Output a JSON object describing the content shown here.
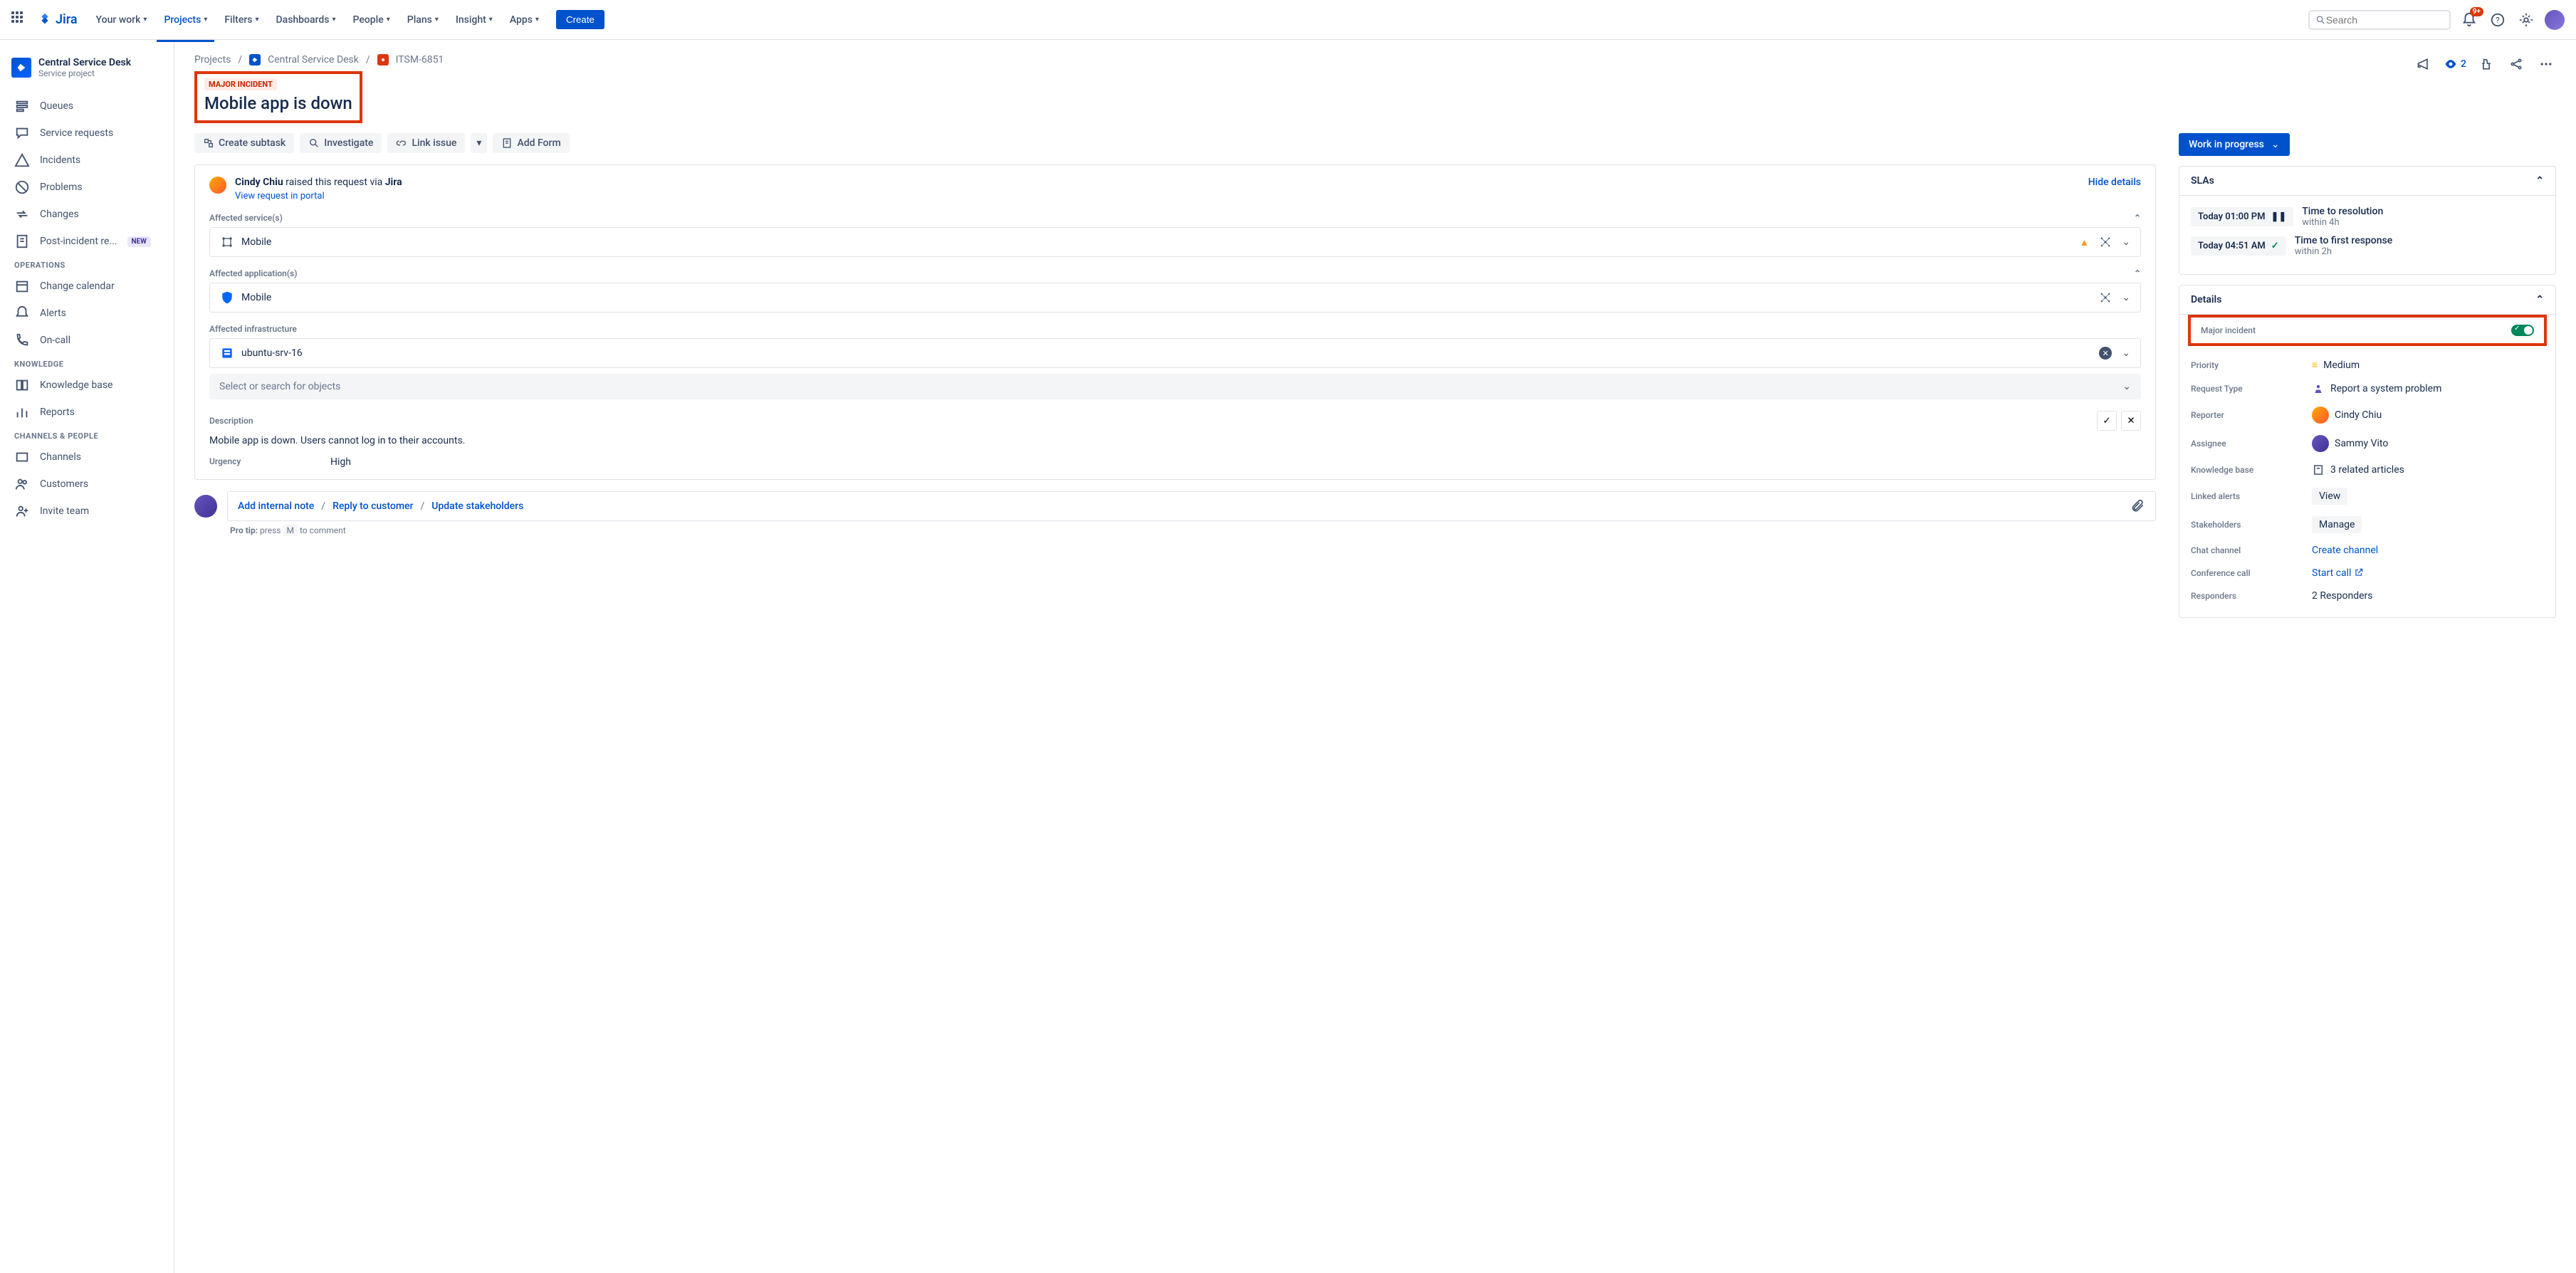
{
  "brand": "Jira",
  "nav": {
    "items": [
      "Your work",
      "Projects",
      "Filters",
      "Dashboards",
      "People",
      "Plans",
      "Insight",
      "Apps"
    ],
    "active_index": 1,
    "create": "Create",
    "search_placeholder": "Search",
    "notif_badge": "9+"
  },
  "project": {
    "name": "Central Service Desk",
    "type": "Service project"
  },
  "sidebar": {
    "main": [
      {
        "icon": "queues",
        "label": "Queues"
      },
      {
        "icon": "service",
        "label": "Service requests"
      },
      {
        "icon": "incidents",
        "label": "Incidents"
      },
      {
        "icon": "problems",
        "label": "Problems"
      },
      {
        "icon": "changes",
        "label": "Changes"
      },
      {
        "icon": "postinc",
        "label": "Post-incident re...",
        "badge": "NEW"
      }
    ],
    "operations_label": "OPERATIONS",
    "operations": [
      {
        "icon": "calendar",
        "label": "Change calendar"
      },
      {
        "icon": "alerts",
        "label": "Alerts"
      },
      {
        "icon": "oncall",
        "label": "On-call"
      }
    ],
    "knowledge_label": "KNOWLEDGE",
    "knowledge": [
      {
        "icon": "kb",
        "label": "Knowledge base"
      },
      {
        "icon": "reports",
        "label": "Reports"
      }
    ],
    "channels_label": "CHANNELS & PEOPLE",
    "channels": [
      {
        "icon": "channels",
        "label": "Channels"
      },
      {
        "icon": "customers",
        "label": "Customers"
      },
      {
        "icon": "invite",
        "label": "Invite team"
      }
    ]
  },
  "breadcrumb": {
    "root": "Projects",
    "project": "Central Service Desk",
    "key": "ITSM-6851"
  },
  "issue": {
    "badge": "MAJOR INCIDENT",
    "title": "Mobile app is down",
    "toolbar": {
      "subtask": "Create subtask",
      "investigate": "Investigate",
      "link": "Link issue",
      "form": "Add Form"
    },
    "requester": {
      "name": "Cindy Chiu",
      "text": " raised this request via ",
      "app": "Jira",
      "portal": "View request in portal",
      "hide": "Hide details"
    },
    "sections": {
      "services_label": "Affected service(s)",
      "service": "Mobile",
      "apps_label": "Affected application(s)",
      "app": "Mobile",
      "infra_label": "Affected infrastructure",
      "infra": "ubuntu-srv-16",
      "object_placeholder": "Select or search for objects",
      "desc_label": "Description",
      "desc": "Mobile app is down. Users cannot log in to their accounts.",
      "urgency_label": "Urgency",
      "urgency": "High"
    },
    "comment": {
      "internal": "Add internal note",
      "reply": "Reply to customer",
      "stakeholders": "Update stakeholders",
      "tip_label": "Pro tip:",
      "tip_press": " press ",
      "tip_key": "M",
      "tip_end": " to comment"
    },
    "status": "Work in progress",
    "watch_count": "2",
    "slas": {
      "header": "SLAs",
      "rows": [
        {
          "time": "Today 01:00 PM",
          "icon": "pause",
          "name": "Time to resolution",
          "within": "within 4h"
        },
        {
          "time": "Today 04:51 AM",
          "icon": "check",
          "name": "Time to first response",
          "within": "within 2h"
        }
      ]
    },
    "details": {
      "header": "Details",
      "major_label": "Major incident",
      "rows": {
        "priority": {
          "label": "Priority",
          "value": "Medium"
        },
        "request_type": {
          "label": "Request Type",
          "value": "Report a system problem"
        },
        "reporter": {
          "label": "Reporter",
          "value": "Cindy Chiu"
        },
        "assignee": {
          "label": "Assignee",
          "value": "Sammy Vito"
        },
        "kb": {
          "label": "Knowledge base",
          "value": "3 related articles"
        },
        "alerts": {
          "label": "Linked alerts",
          "value": "View"
        },
        "stakeholders": {
          "label": "Stakeholders",
          "value": "Manage"
        },
        "chat": {
          "label": "Chat channel",
          "value": "Create channel"
        },
        "call": {
          "label": "Conference call",
          "value": "Start call"
        },
        "responders": {
          "label": "Responders",
          "value": "2 Responders"
        }
      }
    }
  }
}
